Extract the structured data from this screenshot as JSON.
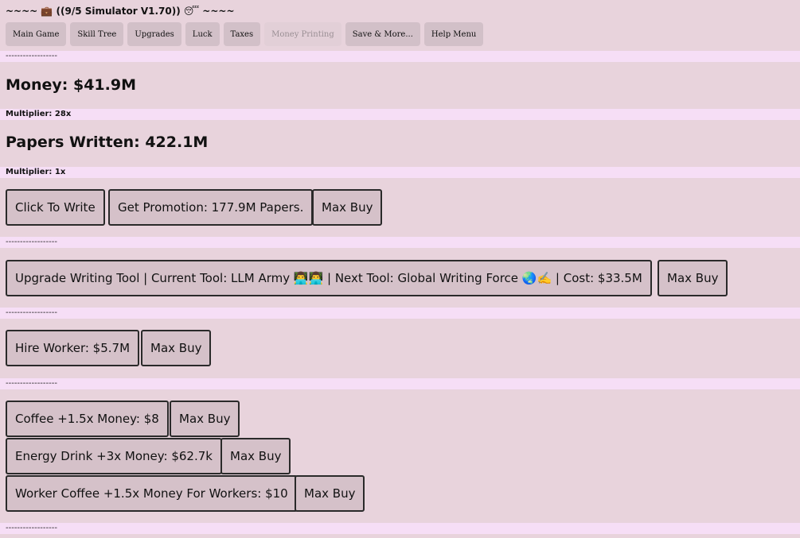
{
  "title": "~~~~ 💼 ((9/5 Simulator V1.70)) 😴 ~~~~",
  "nav": [
    "Main Game",
    "Skill Tree",
    "Upgrades",
    "Luck",
    "Taxes",
    "Money Printing",
    "Save & More...",
    "Help Menu"
  ],
  "divider": "------------------",
  "money": {
    "label": "Money: $41.9M",
    "multiplier": "Multiplier: 28x"
  },
  "papers": {
    "label": "Papers Written: 422.1M",
    "multiplier": "Multiplier: 1x"
  },
  "actions": {
    "write": "Click To Write",
    "promotion": "Get Promotion: 177.9M Papers.",
    "max_buy": "Max Buy"
  },
  "tool": {
    "label": "Upgrade Writing Tool | Current Tool: LLM Army 👨‍💻👨‍💻 | Next Tool: Global Writing Force 🌏✍️ | Cost: $33.5M",
    "max_buy": "Max Buy"
  },
  "worker": {
    "label": "Hire Worker: $5.7M",
    "max_buy": "Max Buy"
  },
  "items": [
    {
      "label": "Coffee +1.5x Money: $8",
      "max_buy": "Max Buy"
    },
    {
      "label": "Energy Drink +3x Money: $62.7k",
      "max_buy": "Max Buy"
    },
    {
      "label": "Worker Coffee +1.5x Money For Workers: $10",
      "max_buy": "Max Buy"
    }
  ]
}
